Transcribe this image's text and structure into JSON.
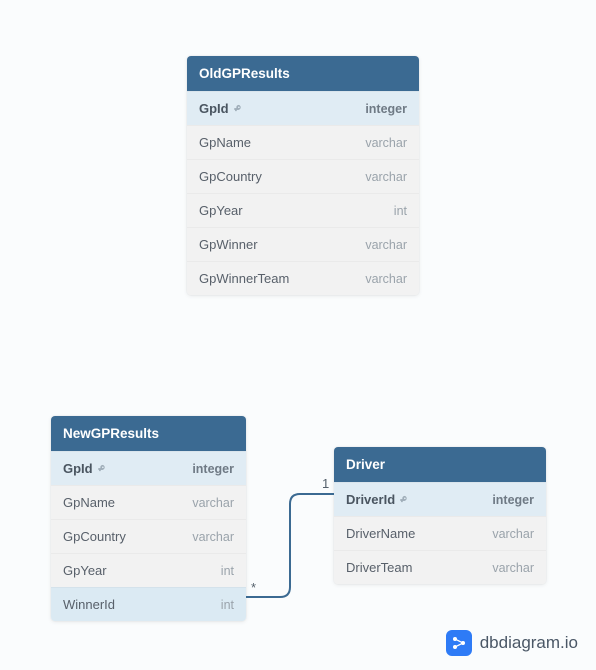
{
  "tables": {
    "oldgp": {
      "title": "OldGPResults",
      "columns": [
        {
          "name": "GpId",
          "type": "integer",
          "pk": true
        },
        {
          "name": "GpName",
          "type": "varchar"
        },
        {
          "name": "GpCountry",
          "type": "varchar"
        },
        {
          "name": "GpYear",
          "type": "int"
        },
        {
          "name": "GpWinner",
          "type": "varchar"
        },
        {
          "name": "GpWinnerTeam",
          "type": "varchar"
        }
      ]
    },
    "newgp": {
      "title": "NewGPResults",
      "columns": [
        {
          "name": "GpId",
          "type": "integer",
          "pk": true
        },
        {
          "name": "GpName",
          "type": "varchar"
        },
        {
          "name": "GpCountry",
          "type": "varchar"
        },
        {
          "name": "GpYear",
          "type": "int"
        },
        {
          "name": "WinnerId",
          "type": "int",
          "hl": true
        }
      ]
    },
    "driver": {
      "title": "Driver",
      "columns": [
        {
          "name": "DriverId",
          "type": "integer",
          "pk": true
        },
        {
          "name": "DriverName",
          "type": "varchar"
        },
        {
          "name": "DriverTeam",
          "type": "varchar"
        }
      ]
    }
  },
  "relationship": {
    "from_label": "*",
    "to_label": "1"
  },
  "watermark": {
    "text": "dbdiagram.io"
  }
}
